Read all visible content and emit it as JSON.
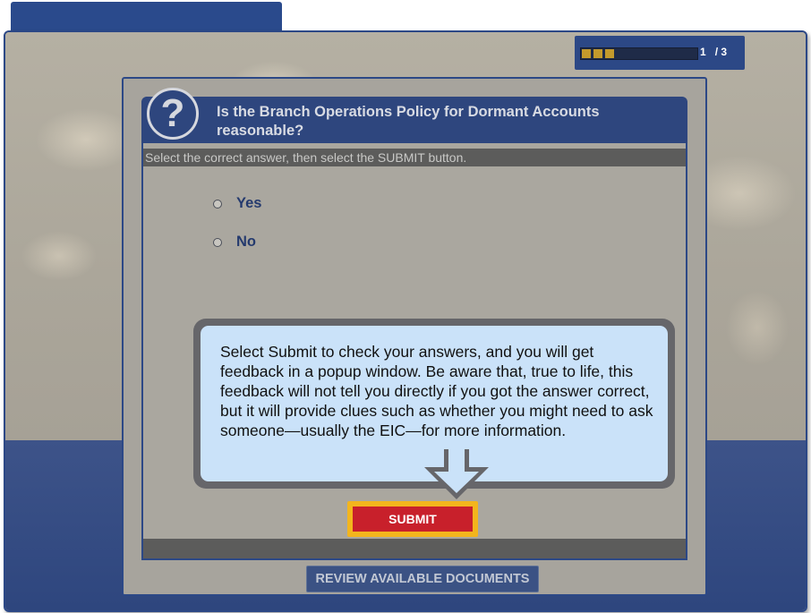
{
  "progress": {
    "current": "1",
    "total": "/ 3",
    "fraction": 0.33
  },
  "question": {
    "icon": "question-mark-icon",
    "title": "Is the Branch Operations Policy for Dormant Accounts reasonable?",
    "instruction": "Select the correct answer, then select the SUBMIT button.",
    "options": [
      {
        "label": "Yes",
        "selected": false
      },
      {
        "label": "No",
        "selected": false
      }
    ]
  },
  "callout": {
    "text": "Select Submit to check your answers, and you will get feedback in a popup window. Be aware that, true to life, this feedback will not tell you directly if you got the answer correct, but it will provide clues such as whether you might need to ask someone—usually the EIC—for more information."
  },
  "buttons": {
    "submit": "SUBMIT",
    "review": "REVIEW AVAILABLE DOCUMENTS"
  },
  "colors": {
    "brand_blue": "#2e467e",
    "progress_fill": "#c49a2c",
    "submit_red": "#c8202b",
    "submit_highlight": "#f3b51d",
    "callout_bg": "#cae2f9"
  }
}
